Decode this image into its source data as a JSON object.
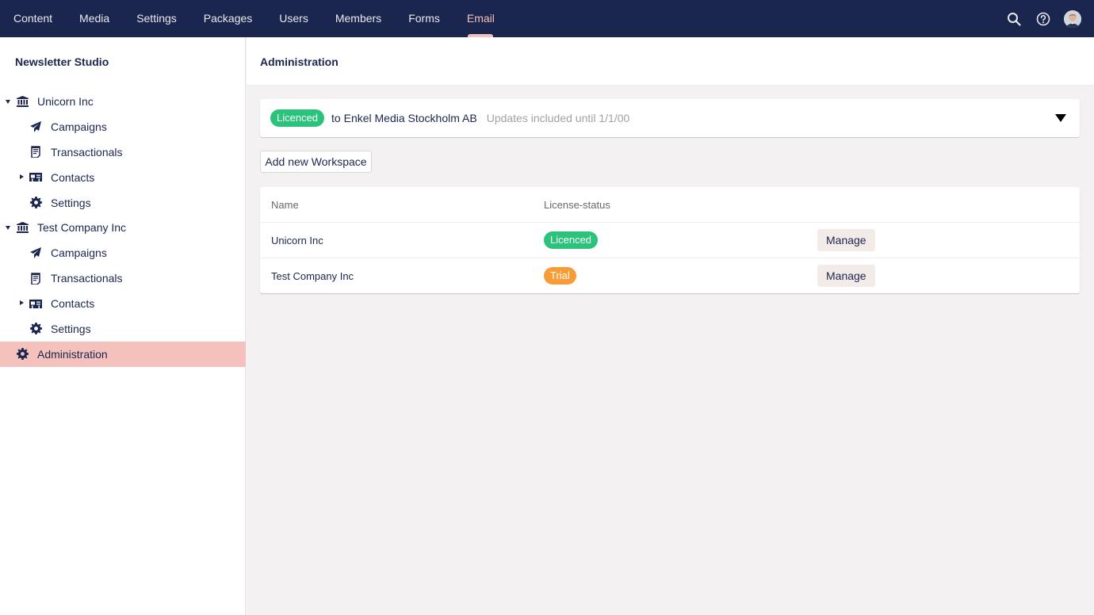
{
  "topnav": {
    "items": [
      {
        "label": "Content"
      },
      {
        "label": "Media"
      },
      {
        "label": "Settings"
      },
      {
        "label": "Packages"
      },
      {
        "label": "Users"
      },
      {
        "label": "Members"
      },
      {
        "label": "Forms"
      },
      {
        "label": "Email",
        "active": true
      }
    ],
    "icons": [
      "search-icon",
      "help-icon",
      "user-avatar"
    ]
  },
  "sidebar": {
    "title": "Newsletter Studio",
    "tree": [
      {
        "label": "Unicorn Inc",
        "icon": "bank-icon",
        "expanded": true,
        "children": [
          {
            "label": "Campaigns",
            "icon": "paper-plane-icon"
          },
          {
            "label": "Transactionals",
            "icon": "receipt-icon"
          },
          {
            "label": "Contacts",
            "icon": "contact-card-icon",
            "expandable": true
          },
          {
            "label": "Settings",
            "icon": "gear-icon"
          }
        ]
      },
      {
        "label": "Test Company Inc",
        "icon": "bank-icon",
        "expanded": true,
        "children": [
          {
            "label": "Campaigns",
            "icon": "paper-plane-icon"
          },
          {
            "label": "Transactionals",
            "icon": "receipt-icon"
          },
          {
            "label": "Contacts",
            "icon": "contact-card-icon",
            "expandable": true
          },
          {
            "label": "Settings",
            "icon": "gear-icon"
          }
        ]
      },
      {
        "label": "Administration",
        "icon": "gear-icon",
        "active": true
      }
    ]
  },
  "main": {
    "title": "Administration",
    "license": {
      "status": "Licenced",
      "to": "to Enkel Media Stockholm AB",
      "updates": "Updates included until 1/1/00"
    },
    "add_workspace_label": "Add new Workspace",
    "table": {
      "headers": {
        "name": "Name",
        "status": "License-status"
      },
      "rows": [
        {
          "name": "Unicorn Inc",
          "status": "Licenced",
          "action": "Manage"
        },
        {
          "name": "Test Company Inc",
          "status": "Trial",
          "action": "Manage"
        }
      ]
    }
  },
  "colors": {
    "nav_bg": "#1b264f",
    "accent": "#f5c1bc",
    "licenced": "#2bc37c",
    "trial": "#f79c37"
  }
}
